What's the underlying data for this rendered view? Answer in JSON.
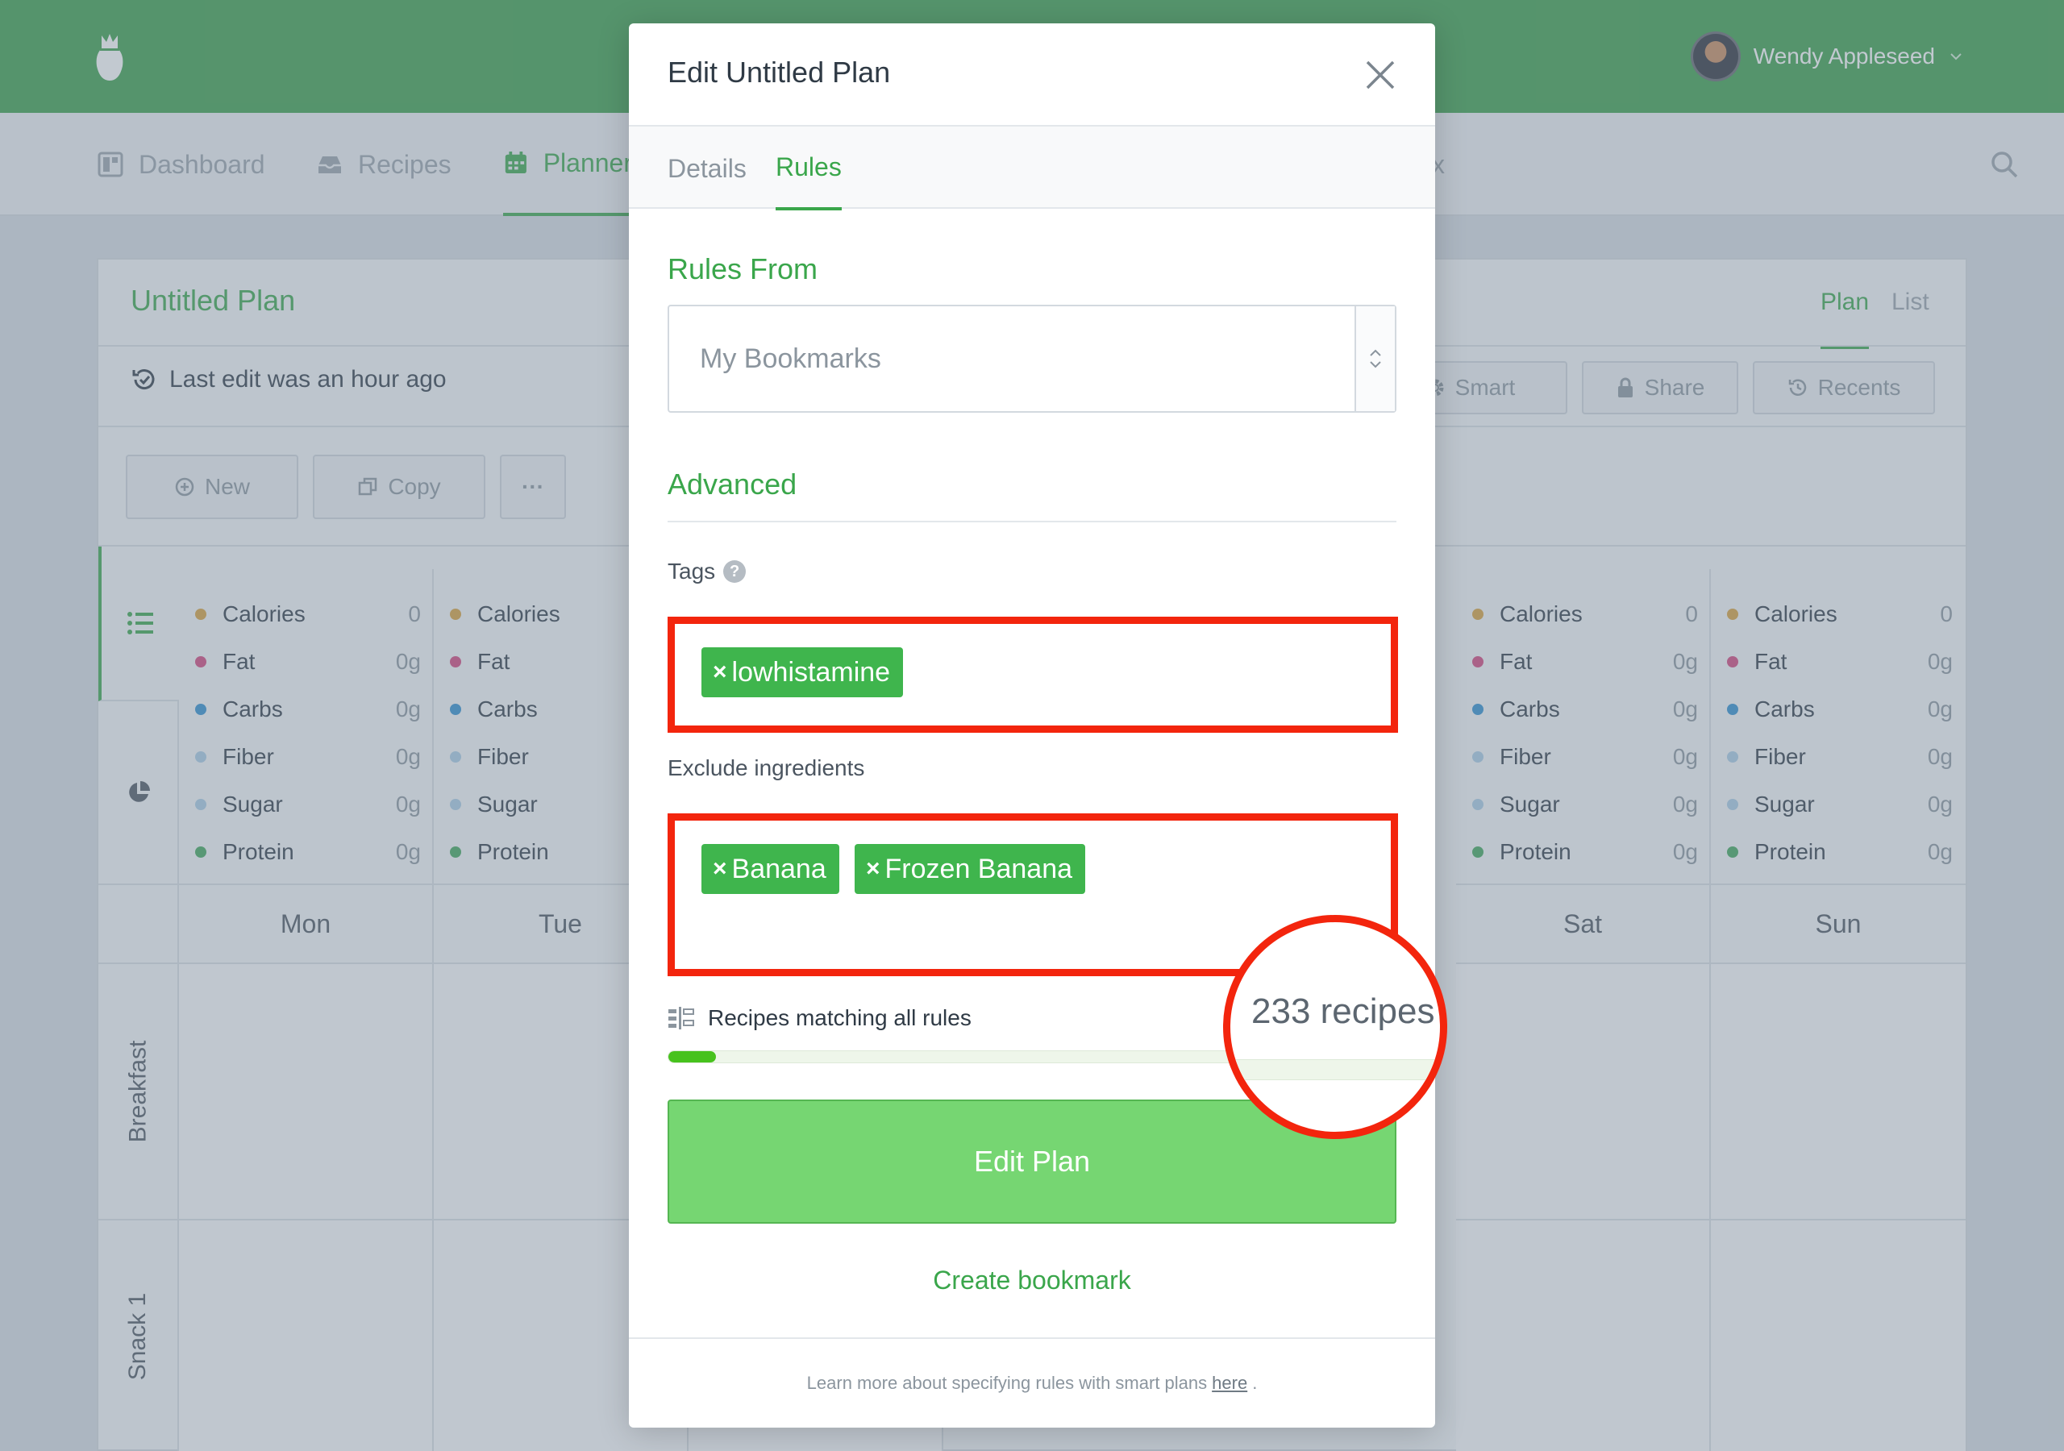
{
  "header": {
    "user_name": "Wendy Appleseed"
  },
  "nav": {
    "items": [
      "Dashboard",
      "Recipes",
      "Planner"
    ],
    "partial_right": "x"
  },
  "plan": {
    "title": "Untitled Plan",
    "view_plan": "Plan",
    "view_list": "List",
    "last_edit": "Last edit was an hour ago",
    "buttons": {
      "new": "New",
      "copy": "Copy",
      "more": "···",
      "smart": "Smart",
      "share": "Share",
      "recents": "Recents"
    },
    "nutrients": [
      {
        "name": "Calories",
        "value": "0",
        "color": "#d9a13b"
      },
      {
        "name": "Fat",
        "value": "0g",
        "color": "#d4447c"
      },
      {
        "name": "Carbs",
        "value": "0g",
        "color": "#2f8ed0"
      },
      {
        "name": "Fiber",
        "value": "0g",
        "color": "#a9cde6"
      },
      {
        "name": "Sugar",
        "value": "0g",
        "color": "#a9cde6"
      },
      {
        "name": "Protein",
        "value": "0g",
        "color": "#3fa75a"
      }
    ],
    "days": [
      "Mon",
      "Tue",
      "Sat",
      "Sun"
    ],
    "meals": [
      "Breakfast",
      "Snack 1"
    ]
  },
  "modal": {
    "title": "Edit Untitled Plan",
    "tabs": [
      "Details",
      "Rules"
    ],
    "rules_from_title": "Rules From",
    "rules_from_value": "My Bookmarks",
    "advanced_title": "Advanced",
    "tags_label": "Tags",
    "tags": [
      "lowhistamine"
    ],
    "exclude_label": "Exclude ingredients",
    "exclude": [
      "Banana",
      "Frozen Banana"
    ],
    "match_label": "Recipes matching all rules",
    "match_count": "233 recipes",
    "match_fraction": 0.065,
    "edit_button": "Edit Plan",
    "bookmark_link": "Create bookmark",
    "footer_text": "Learn more about specifying rules with smart plans",
    "footer_link": "here",
    "footer_end": "."
  },
  "colors": {
    "brand_green": "#3a9f4a",
    "accent_green": "#3aa64b",
    "highlight_red": "#f3250d"
  },
  "icons": [
    "logo-icon",
    "chevron-down-icon",
    "dashboard-icon",
    "recipes-icon",
    "planner-icon",
    "search-icon",
    "history-icon",
    "plus-circle-icon",
    "copy-icon",
    "gear-icon",
    "lock-icon",
    "list-icon",
    "pie-chart-icon",
    "close-icon",
    "updown-icon",
    "help-icon",
    "filter-icon"
  ]
}
